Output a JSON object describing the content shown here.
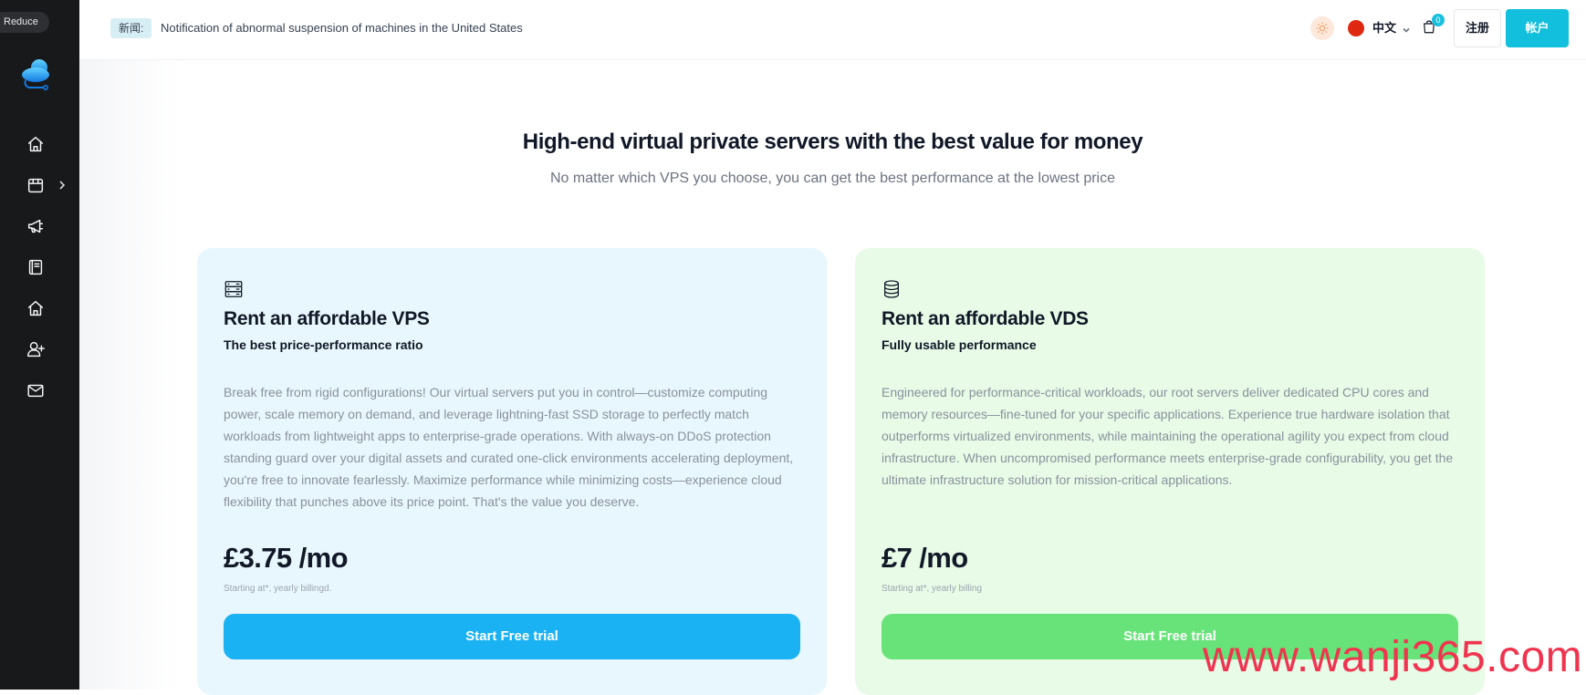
{
  "sidebar": {
    "reduce_label": "Reduce",
    "items": [
      {
        "icon": "home-icon"
      },
      {
        "icon": "store-icon"
      },
      {
        "icon": "megaphone-icon"
      },
      {
        "icon": "book-icon"
      },
      {
        "icon": "house-icon"
      },
      {
        "icon": "user-plus-icon"
      },
      {
        "icon": "mail-icon"
      }
    ]
  },
  "header": {
    "news_tag": "新闻:",
    "news_text": "Notification of abnormal suspension of machines in the United States",
    "language": "中文",
    "cart_count": "0",
    "register_label": "注册",
    "account_label": "帐户",
    "accent_color": "#12bfdc"
  },
  "hero": {
    "title": "High-end virtual private servers with the best value for money",
    "subtitle": "No matter which VPS you choose, you can get the best performance at the lowest price"
  },
  "cards": [
    {
      "title": "Rent an affordable VPS",
      "subtitle": "The best price-performance ratio",
      "description": "Break free from rigid configurations! Our virtual servers put you in control—customize computing power, scale memory on demand, and leverage lightning-fast SSD storage to perfectly match workloads from lightweight apps to enterprise-grade operations. With always-on DDoS protection standing guard over your digital assets and curated one-click environments accelerating deployment, you're free to innovate fearlessly. Maximize performance while minimizing costs—experience cloud flexibility that punches above its price point. That's the value you deserve.",
      "price": "£3.75 /mo",
      "note": "Starting at*, yearly billingd.",
      "button_label": "Start Free trial",
      "button_color": "#1ab2f2"
    },
    {
      "title": "Rent an affordable VDS",
      "subtitle": "Fully usable performance",
      "description": "Engineered for performance-critical workloads, our root servers deliver dedicated CPU cores and memory resources—fine-tuned for your specific applications. Experience true hardware isolation that outperforms virtualized environments, while maintaining the operational agility you expect from cloud infrastructure. When uncompromised performance meets enterprise-grade configurability, you get the ultimate infrastructure solution for mission-critical applications.",
      "price": "£7 /mo",
      "note": "Starting at*, yearly billing",
      "button_label": "Start Free trial",
      "button_color": "#68e37a"
    }
  ],
  "watermark": "www.wanji365.com"
}
